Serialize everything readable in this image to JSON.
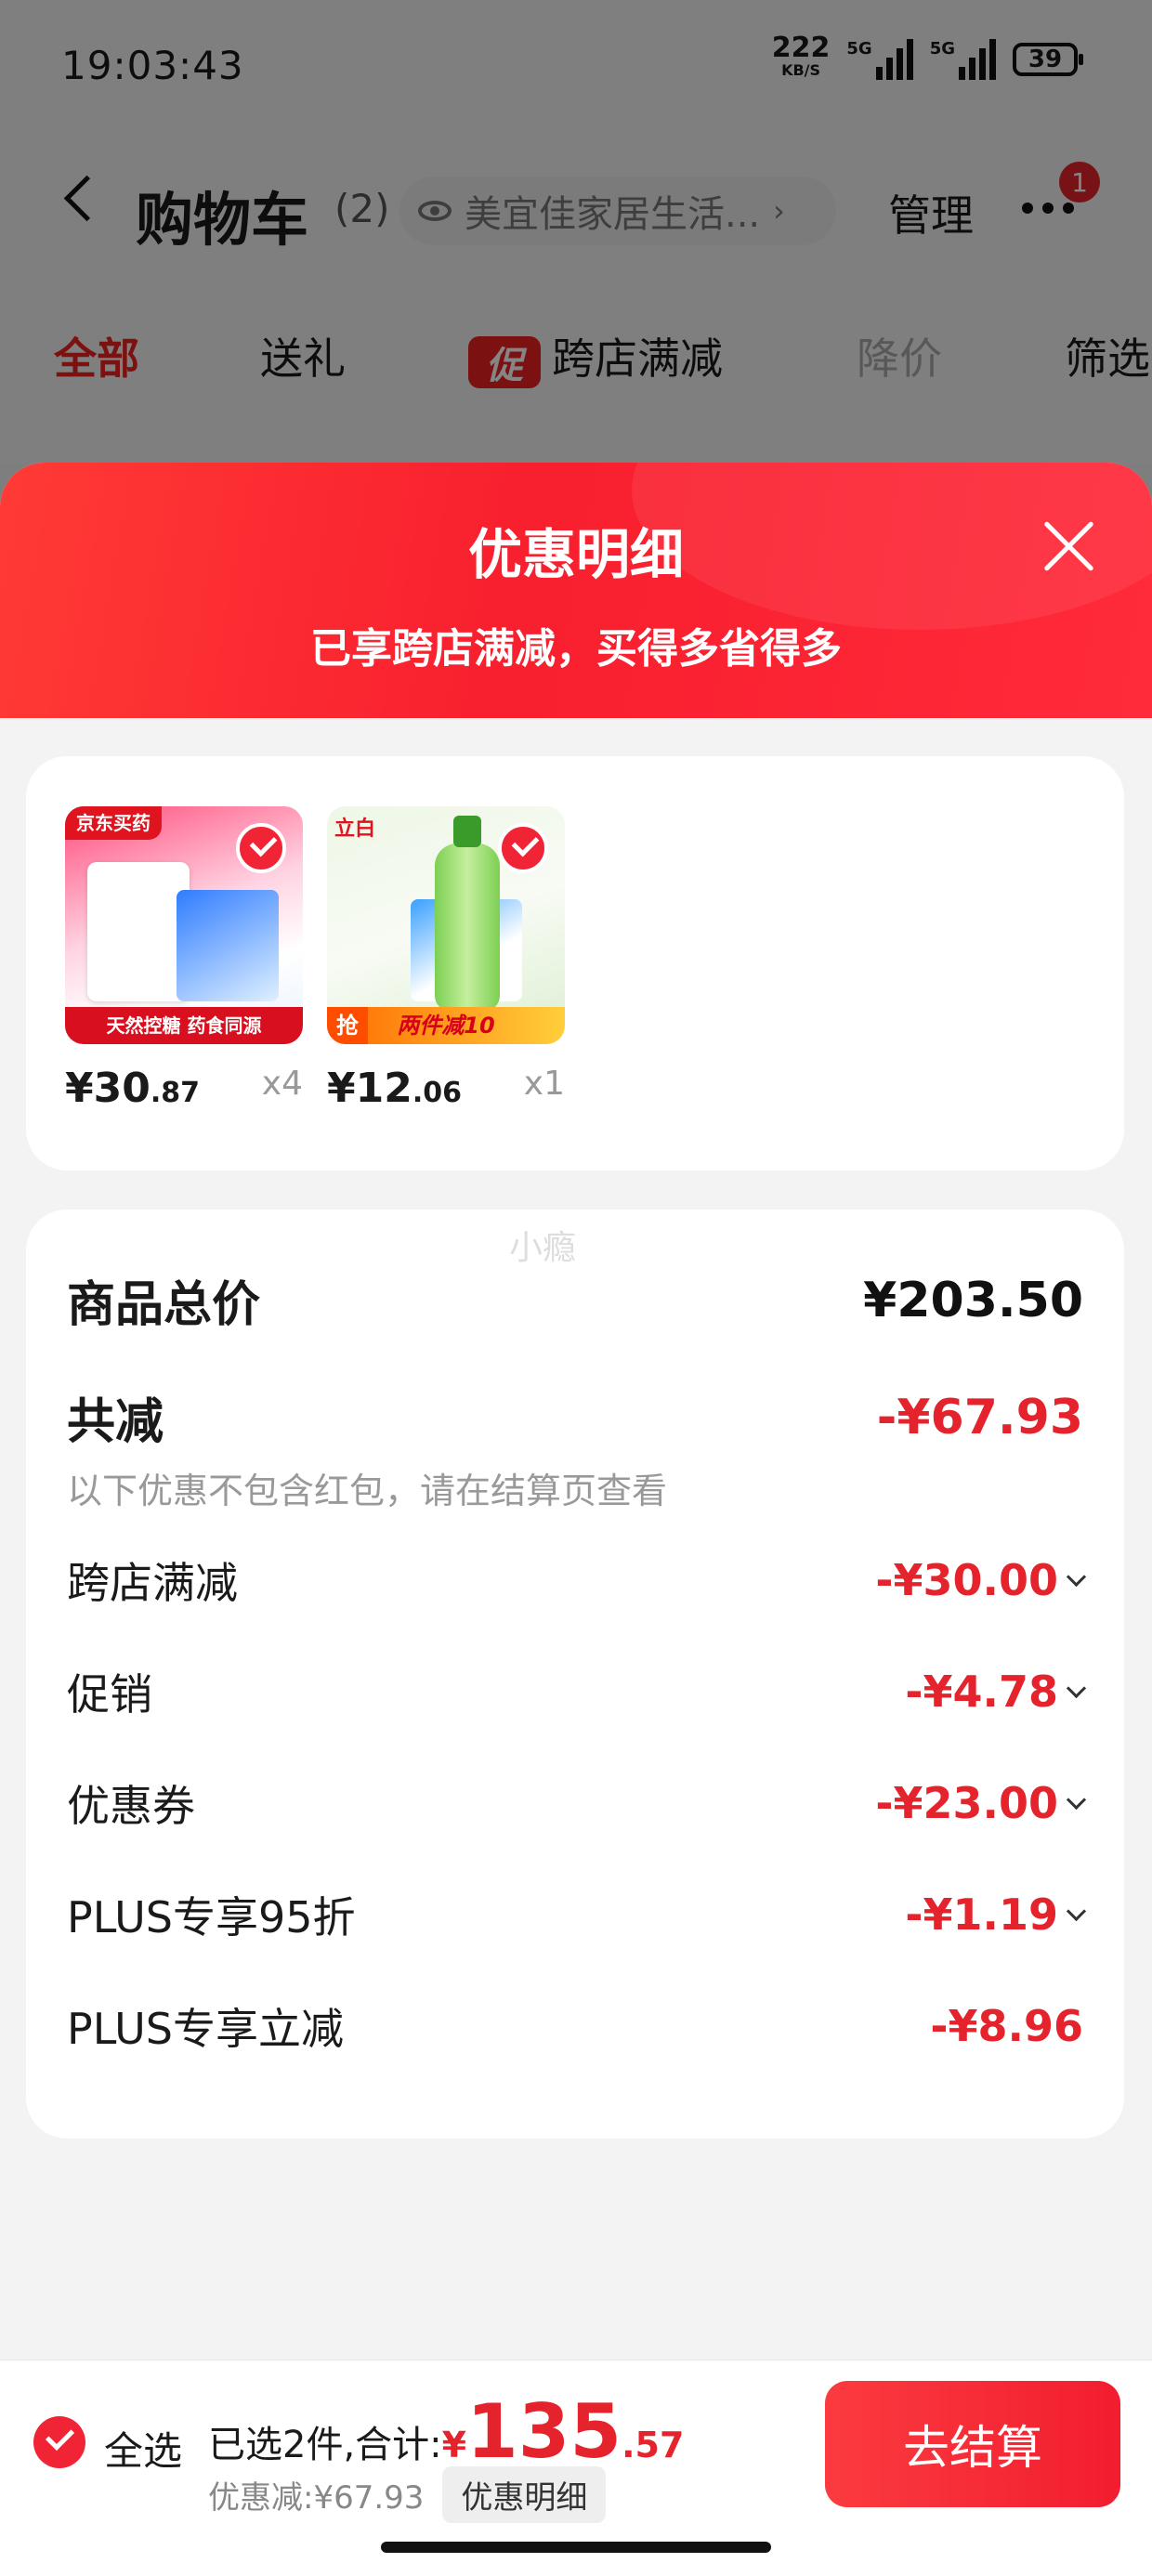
{
  "status_bar": {
    "time": "19:03:43",
    "net_speed": "222",
    "net_unit": "KB/S",
    "sig1_label": "5G",
    "sig2_label": "5G",
    "battery": "39"
  },
  "header": {
    "title": "购物车",
    "count": "(2)",
    "store": "美宜佳家居生活...",
    "manage": "管理",
    "badge": "1"
  },
  "filters": {
    "all": "全部",
    "gift": "送礼",
    "promo_tag": "促",
    "cross_store": "跨店满减",
    "price_drop": "降价",
    "filter": "筛选"
  },
  "sheet": {
    "title": "优惠明细",
    "subtitle": "已享跨店满减，买得多省得多"
  },
  "products": [
    {
      "price_int": "¥30",
      "price_dec": ".87",
      "qty": "x4",
      "brand": "京东买药",
      "banner": "天然控糖 药食同源"
    },
    {
      "price_int": "¥12",
      "price_dec": ".06",
      "qty": "x1",
      "brand": "立白",
      "banner": "两件减10",
      "flag": "抢"
    }
  ],
  "watermark": "小瘾",
  "summary": {
    "total_label": "商品总价",
    "total_value": "¥203.50",
    "reduce_label": "共减",
    "reduce_value": "-¥67.93",
    "note": "以下优惠不包含红包，请在结算页查看",
    "items": [
      {
        "label": "跨店满减",
        "value": "-¥30.00"
      },
      {
        "label": "促销",
        "value": "-¥4.78"
      },
      {
        "label": "优惠券",
        "value": "-¥23.00"
      },
      {
        "label": "PLUS专享95折",
        "value": "-¥1.19"
      },
      {
        "label": "PLUS专享立减",
        "value": "-¥8.96"
      }
    ]
  },
  "bottom": {
    "select_all": "全选",
    "selected_text": "已选2件,合计:",
    "currency": "¥",
    "amount_int": "135",
    "amount_dec": ".57",
    "saved": "优惠减:¥67.93",
    "detail": "优惠明细",
    "checkout": "去结算"
  },
  "colors": {
    "accent": "#e4232c",
    "header_red": "#f81f2e"
  }
}
